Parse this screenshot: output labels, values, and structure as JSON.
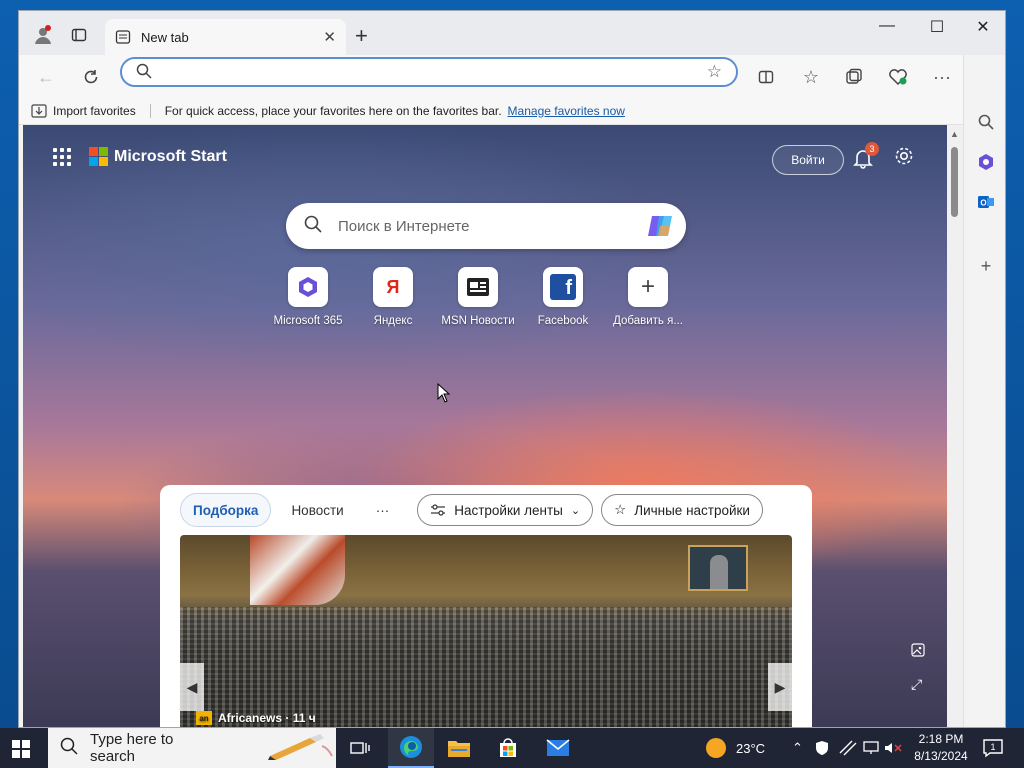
{
  "browser": {
    "tab_title": "New tab",
    "address_value": "",
    "import_favorites": "Import favorites",
    "fav_message": "For quick access, place your favorites here on the favorites bar.",
    "manage_favorites": "Manage favorites now"
  },
  "start": {
    "brand": "Microsoft Start",
    "signin": "Войти",
    "notification_count": "3",
    "search_placeholder": "Поиск в Интернете",
    "tiles": [
      {
        "label": "Microsoft 365",
        "icon": "microsoft-365-icon"
      },
      {
        "label": "Яндекс",
        "icon": "yandex-icon"
      },
      {
        "label": "MSN Новости",
        "icon": "msn-news-icon"
      },
      {
        "label": "Facebook",
        "icon": "facebook-icon"
      },
      {
        "label": "Добавить я...",
        "icon": "add-icon"
      }
    ]
  },
  "feed": {
    "tabs": [
      "Подборка",
      "Новости",
      "···"
    ],
    "feed_settings": "Настройки ленты",
    "personal_settings": "Личные настройки",
    "source": "Africanews · 11 ч",
    "source_logo": "an"
  },
  "taskbar": {
    "search_placeholder": "Type here to search",
    "weather": "23°C",
    "time": "2:18 PM",
    "date": "8/13/2024",
    "notifications": "1"
  },
  "colors": {
    "accent": "#1f5fb4",
    "address_border": "#5b8fd1",
    "taskbar": "#1f2535"
  }
}
